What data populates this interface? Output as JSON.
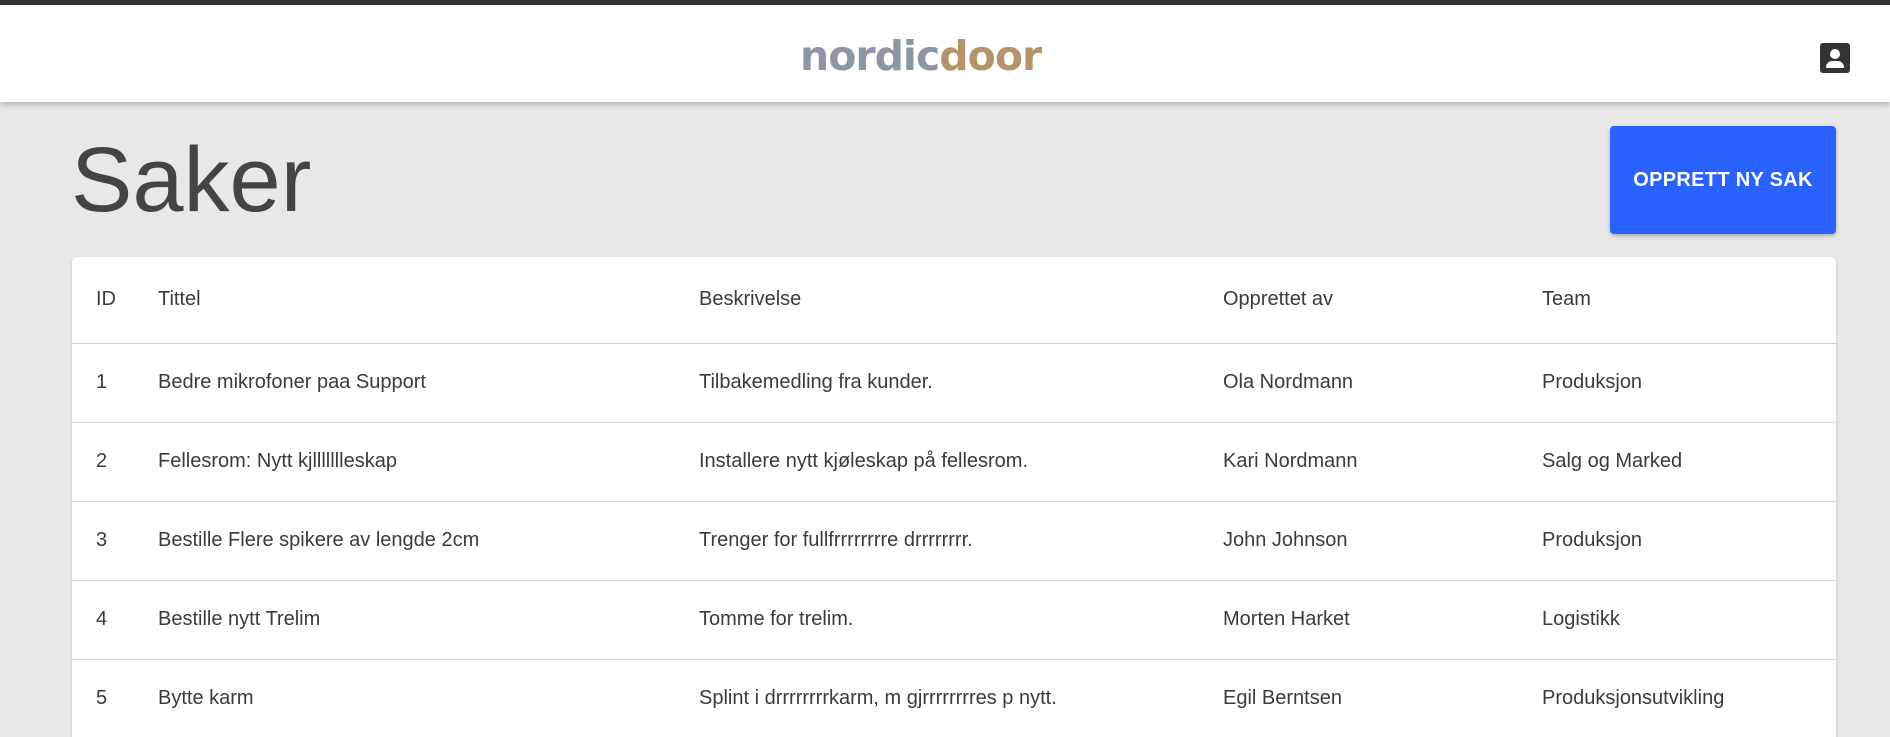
{
  "header": {
    "logo_part1": "nordic",
    "logo_part2": "door"
  },
  "page": {
    "title": "Saker",
    "create_button_label": "OPPRETT NY SAK"
  },
  "table": {
    "columns": [
      "ID",
      "Tittel",
      "Beskrivelse",
      "Opprettet av",
      "Team"
    ],
    "rows": [
      [
        "1",
        "Bedre mikrofoner paa Support",
        "Tilbakemedling fra kunder.",
        "Ola Nordmann",
        "Produksjon"
      ],
      [
        "2",
        "Fellesrom: Nytt kjllllllleskap",
        "Installere nytt kjøleskap på fellesrom.",
        "Kari Nordmann",
        "Salg og Marked"
      ],
      [
        "3",
        "Bestille Flere spikere av lengde 2cm",
        "Trenger for fullfrrrrrrrre drrrrrrrr.",
        "John Johnson",
        "Produksjon"
      ],
      [
        "4",
        "Bestille nytt Trelim",
        "Tomme for trelim.",
        "Morten Harket",
        "Logistikk"
      ],
      [
        "5",
        "Bytte karm",
        "Splint i drrrrrrrrkarm, m gjrrrrrrrres p nytt.",
        "Egil Berntsen",
        "Produksjonsutvikling"
      ]
    ]
  },
  "colors": {
    "accent": "#2962ff",
    "background": "#e8e8e7",
    "logo_grey": "#8d96a4",
    "logo_gold": "#b5946b"
  },
  "icons": {
    "profile": "account-box-icon"
  }
}
